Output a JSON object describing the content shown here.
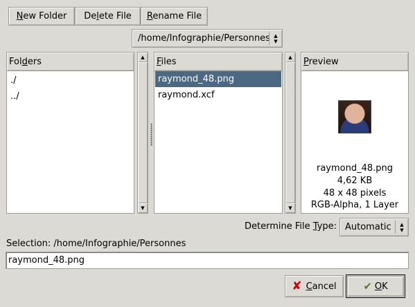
{
  "toolbar": {
    "new_folder": {
      "pre": "",
      "ul": "N",
      "post": "ew Folder"
    },
    "delete_file": {
      "pre": "De",
      "ul": "l",
      "post": "ete File"
    },
    "rename_file": {
      "pre": "",
      "ul": "R",
      "post": "ename File"
    }
  },
  "path_combo": {
    "value": "/home/Infographie/Personnes"
  },
  "folders": {
    "header": {
      "pre": "Fol",
      "ul": "d",
      "post": "ers"
    },
    "items": [
      "./",
      "../"
    ]
  },
  "files": {
    "header": {
      "pre": "",
      "ul": "F",
      "post": "iles"
    },
    "items": [
      "raymond_48.png",
      "raymond.xcf"
    ],
    "selected_index": 0
  },
  "preview": {
    "header": {
      "pre": "",
      "ul": "P",
      "post": "review"
    },
    "filename": "raymond_48.png",
    "size": "4,62 KB",
    "dimensions": "48 x 48 pixels",
    "format": "RGB-Alpha, 1 Layer"
  },
  "file_type": {
    "label": {
      "pre": "Determine File ",
      "ul": "T",
      "post": "ype:"
    },
    "value": "Automatic"
  },
  "selection": {
    "label": "Selection: /home/Infographie/Personnes",
    "value": "raymond_48.png"
  },
  "actions": {
    "cancel": {
      "pre": "",
      "ul": "C",
      "post": "ancel"
    },
    "ok": {
      "pre": "",
      "ul": "O",
      "post": "K"
    }
  },
  "colors": {
    "window_bg": "#dcdad5",
    "selection_bg": "#4b6983",
    "cancel_icon": "#cc0000"
  },
  "icons": {
    "cancel": "cross-icon",
    "ok": "checkmark-hand-icon"
  }
}
